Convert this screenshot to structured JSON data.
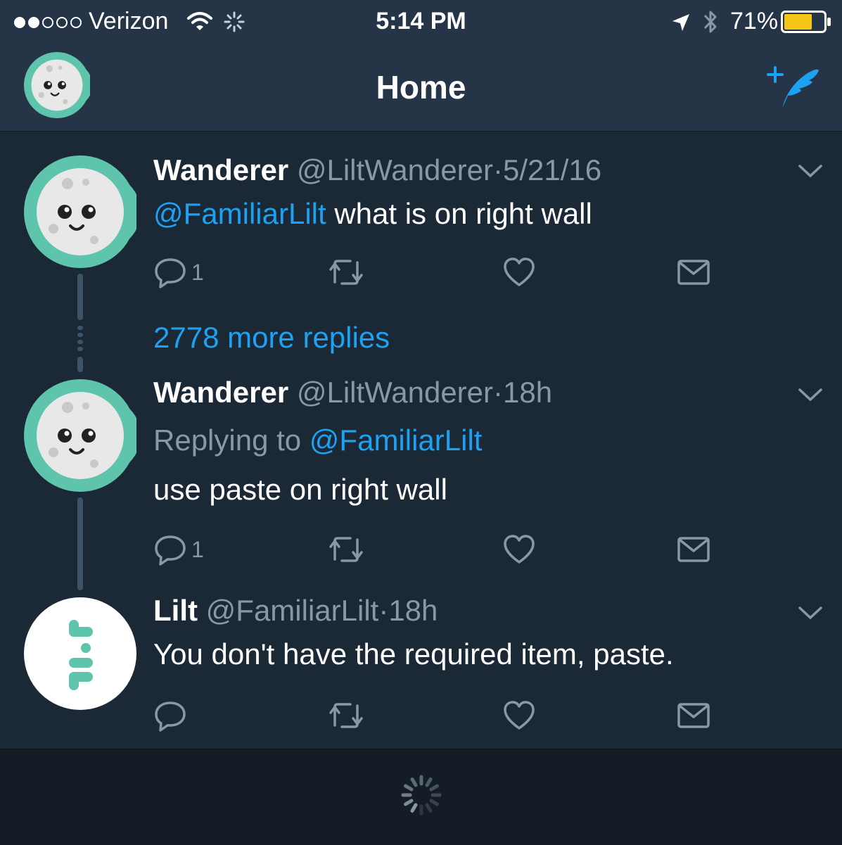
{
  "status_bar": {
    "carrier": "Verizon",
    "time": "5:14 PM",
    "battery": "71%",
    "battery_level": 0.71,
    "signal_bars_filled": 2,
    "signal_bars_total": 5
  },
  "nav": {
    "title": "Home",
    "compose_icon": "compose-tweet-icon",
    "avatar_icon": "moon-avatar"
  },
  "tweets": [
    {
      "name": "Wanderer",
      "handle": "@LiltWanderer",
      "separator": "·",
      "time": "5/21/16",
      "mention": "@FamiliarLilt",
      "text": " what is on right wall",
      "reply_count": "1"
    },
    {
      "name": "Wanderer",
      "handle": "@LiltWanderer",
      "separator": "·",
      "time": "18h",
      "replying_prefix": "Replying to ",
      "replying_to": "@FamiliarLilt",
      "text": "use paste on right wall",
      "reply_count": "1"
    },
    {
      "name": "Lilt",
      "handle": "@FamiliarLilt",
      "separator": "·",
      "time": "18h",
      "text": "You don't have the required item, paste.",
      "reply_count": ""
    }
  ],
  "more_replies": "2778 more replies",
  "colors": {
    "background": "#1b2836",
    "header": "#253447",
    "accent": "#1da1f2",
    "muted": "#8899a6",
    "avatar_teal": "#5fc4ac",
    "battery_yellow": "#f5c518"
  }
}
